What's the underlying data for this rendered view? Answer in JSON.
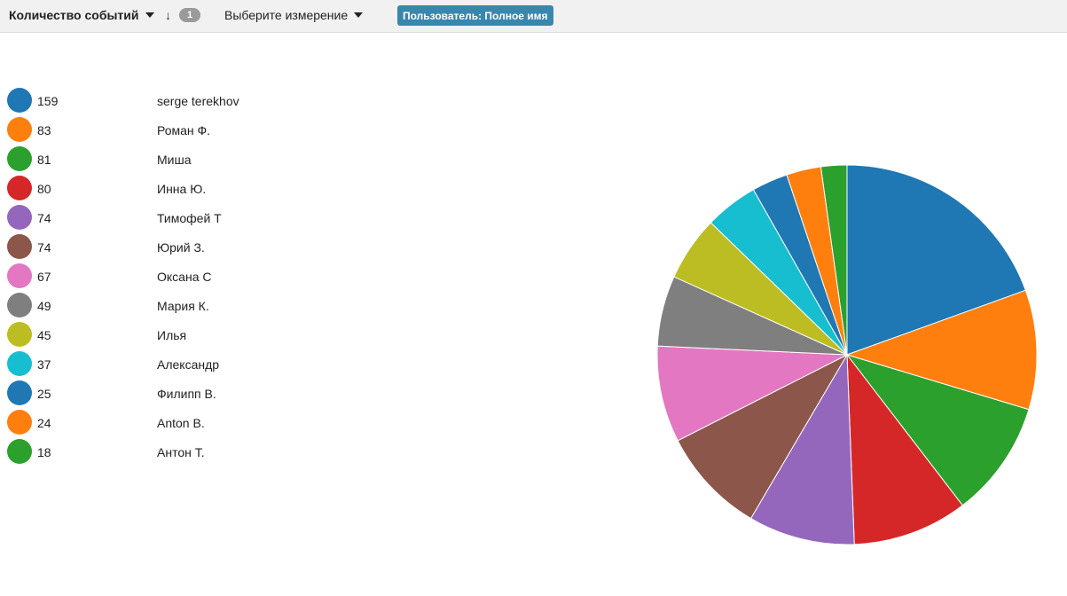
{
  "toolbar": {
    "metric_label": "Количество событий",
    "sort_icon": "sort-descending-icon",
    "count_badge": "1",
    "dimension_placeholder": "Выберите измерение",
    "dimension_chip": "Пользователь: Полное имя"
  },
  "chart_data": {
    "type": "pie",
    "title": "",
    "categories": [
      "serge terekhov",
      "Роман Ф.",
      "Миша",
      "Инна Ю.",
      "Тимофей Т",
      "Юрий З.",
      "Оксана С",
      "Мария К.",
      "Илья",
      "Александр",
      "Филипп В.",
      "Anton B.",
      "Антон Т."
    ],
    "values": [
      159,
      83,
      81,
      80,
      74,
      74,
      67,
      49,
      45,
      37,
      25,
      24,
      18
    ],
    "value_labels": [
      "159",
      "83",
      "81",
      "80",
      "74",
      "74",
      "67",
      "49",
      "45",
      "37",
      "25",
      "24",
      "18"
    ],
    "colors": [
      "#1f77b4",
      "#ff7f0e",
      "#2ca02c",
      "#d62728",
      "#9467bd",
      "#8c564b",
      "#e377c2",
      "#7f7f7f",
      "#bcbd22",
      "#17becf",
      "#1f77b4",
      "#ff7f0e",
      "#2ca02c"
    ],
    "legend_position": "left",
    "start_angle": "top, clockwise"
  }
}
